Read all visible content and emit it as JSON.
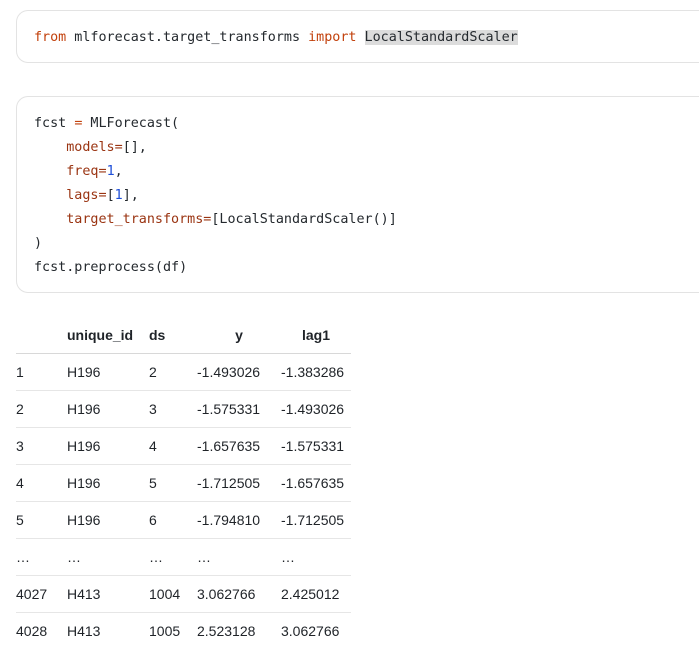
{
  "code_cell_1": {
    "tokens": [
      "from",
      " mlforecast.target_transforms ",
      "import",
      " ",
      "LocalStandardScaler"
    ]
  },
  "code_cell_2": {
    "line1": {
      "a": "fcst ",
      "b": "=",
      "c": " MLForecast("
    },
    "line2": {
      "param": "models=",
      "rest": "[],"
    },
    "line3": {
      "param": "freq=",
      "num": "1",
      "rest": ","
    },
    "line4": {
      "param": "lags=",
      "open": "[",
      "num": "1",
      "rest": "],"
    },
    "line5": {
      "param": "target_transforms=",
      "rest": "[LocalStandardScaler()]"
    },
    "line6": ")",
    "line7": "fcst.preprocess(df)"
  },
  "table": {
    "headers": [
      "",
      "unique_id",
      "ds",
      "y",
      "lag1"
    ],
    "rows": [
      [
        "1",
        "H196",
        "2",
        "-1.493026",
        "-1.383286"
      ],
      [
        "2",
        "H196",
        "3",
        "-1.575331",
        "-1.493026"
      ],
      [
        "3",
        "H196",
        "4",
        "-1.657635",
        "-1.575331"
      ],
      [
        "4",
        "H196",
        "5",
        "-1.712505",
        "-1.657635"
      ],
      [
        "5",
        "H196",
        "6",
        "-1.794810",
        "-1.712505"
      ],
      [
        "…",
        "…",
        "…",
        "…",
        "…"
      ],
      [
        "4027",
        "H413",
        "1004",
        "3.062766",
        "2.425012"
      ],
      [
        "4028",
        "H413",
        "1005",
        "2.523128",
        "3.062766"
      ]
    ]
  }
}
